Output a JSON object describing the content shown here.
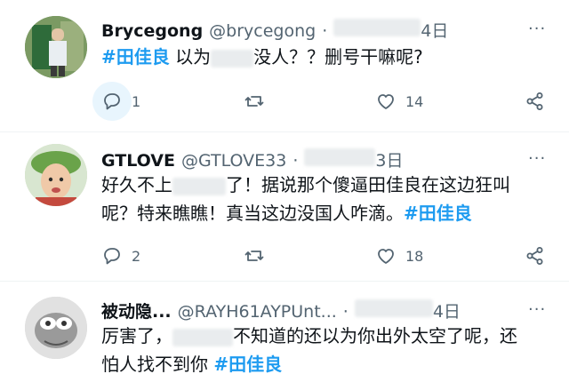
{
  "tweets": [
    {
      "name": "Brycegong",
      "handle": "@brycegong",
      "dot": "·",
      "date": "4日",
      "text_a": "#田佳良",
      "text_b": " 以为",
      "text_c": "没人？？删号干嘛呢?",
      "replies": "1",
      "likes": "14"
    },
    {
      "name": "GTLOVE",
      "handle": "@GTLOVE33",
      "dot": "·",
      "date": "3日",
      "line1_a": "好久不上",
      "line1_b": "了！据说那个傻逼田佳良在这边狂叫",
      "line2_a": "呢？特来瞧瞧！真当这边没国人咋滴。",
      "line2_tag": "#田佳良",
      "replies": "2",
      "likes": "18"
    },
    {
      "name": "被动隐...",
      "handle": "@RAYH61AYPUnt...",
      "dot": "·",
      "date": "4日",
      "line1_a": "厉害了，",
      "line1_b": "不知道的还以为你出外太空了呢，还",
      "line2_a": "怕人找不到你 ",
      "line2_tag": "#田佳良"
    }
  ],
  "icons": {
    "reply": "speech-bubble",
    "retweet": "retweet-arrows",
    "like": "heart",
    "share": "share-nodes",
    "more": "three-dots"
  },
  "colors": {
    "hashtag": "#1d9bf0",
    "secondary": "#536471",
    "primary": "#0f1419",
    "hover": "#e8f5fd"
  }
}
